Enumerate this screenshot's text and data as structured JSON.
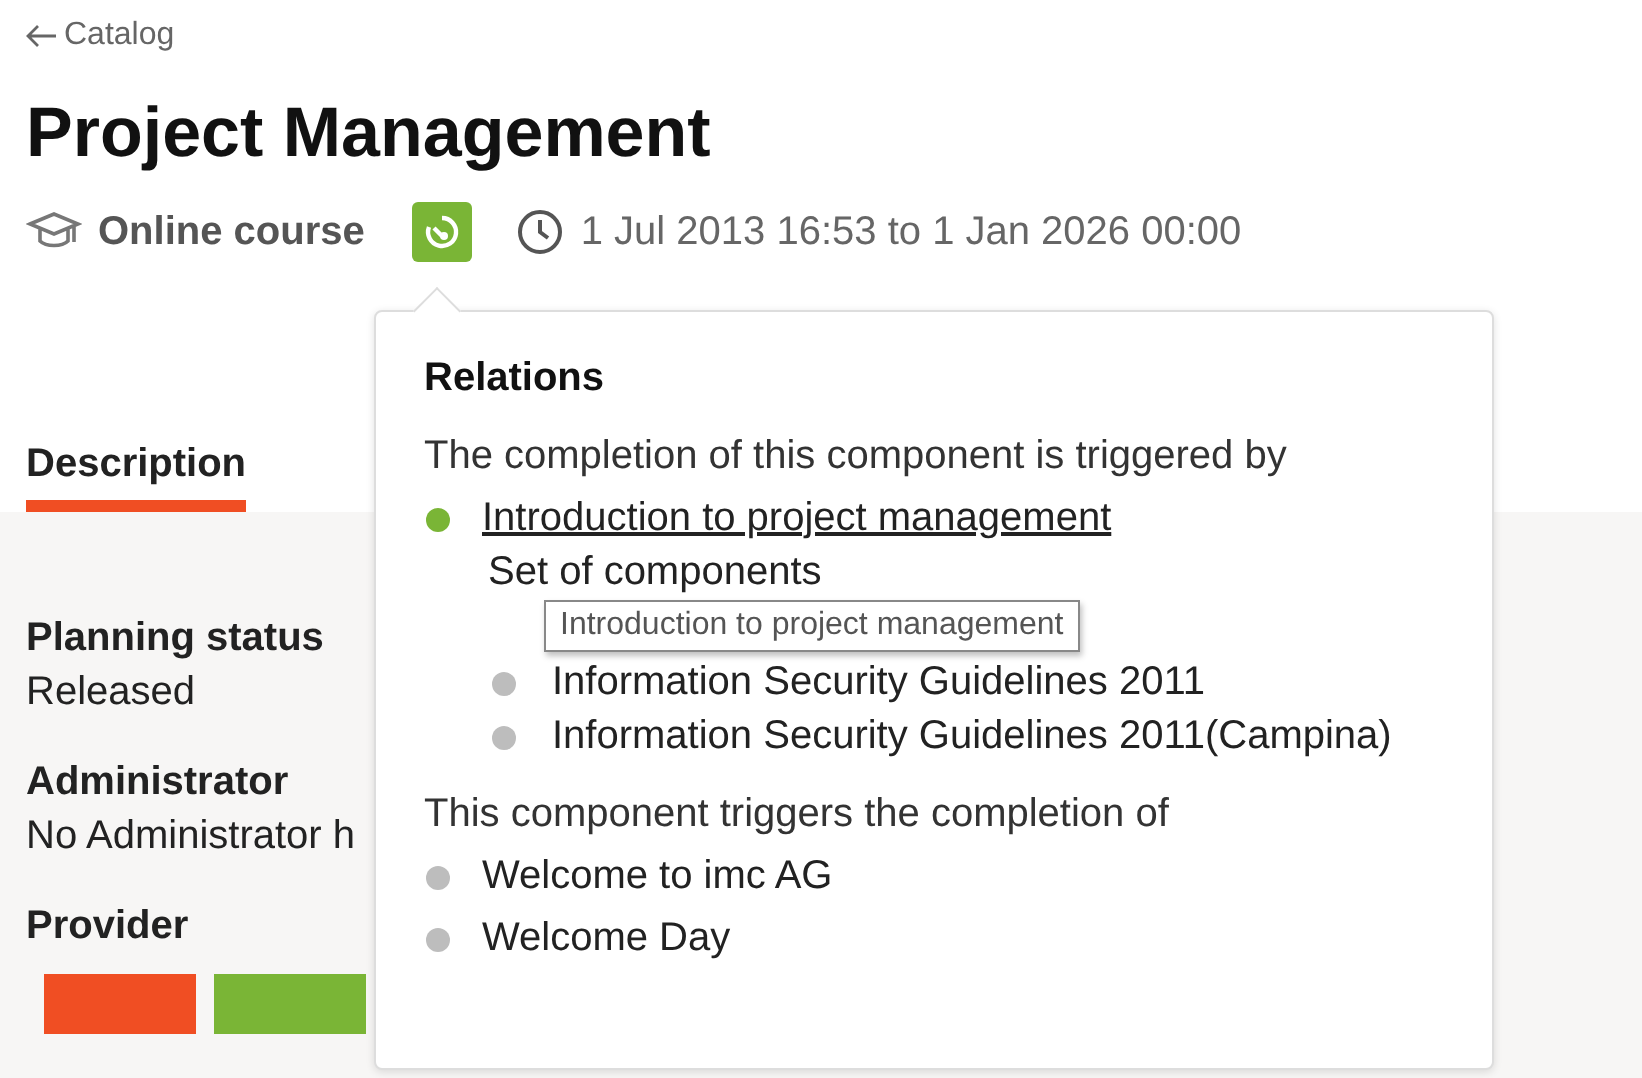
{
  "back_link": {
    "label": "Catalog"
  },
  "title": "Project Management",
  "meta": {
    "type": "Online course",
    "date_range": "1 Jul 2013 16:53 to 1 Jan 2026 00:00"
  },
  "tabs": [
    {
      "label": "Description",
      "selected": true
    }
  ],
  "fields": [
    {
      "label": "Planning status",
      "value": "Released"
    },
    {
      "label": "Administrator",
      "value": "No Administrator h"
    },
    {
      "label": "Provider"
    }
  ],
  "providers": [
    {
      "color": "#f04e23"
    },
    {
      "color": "#7ab536"
    }
  ],
  "relations_popover": {
    "title": "Relations",
    "sections": [
      {
        "heading": "The completion of this component is triggered by",
        "items": [
          {
            "label": "Introduction to project management",
            "kind": "link",
            "color": "#7ab536",
            "group_label": "Set of components",
            "children": [
              {
                "label": "Information Security Guidelines 2011",
                "color": "#bdbdbd"
              },
              {
                "label": "Information Security Guidelines 2011(Campina)",
                "color": "#bdbdbd"
              }
            ]
          }
        ]
      },
      {
        "heading": "This component triggers the completion of",
        "items": [
          {
            "label": "Welcome to imc AG",
            "kind": "plain",
            "color": "#bdbdbd"
          },
          {
            "label": "Welcome Day",
            "kind": "plain",
            "color": "#bdbdbd"
          }
        ]
      }
    ],
    "tooltip": "Introduction to project management"
  }
}
